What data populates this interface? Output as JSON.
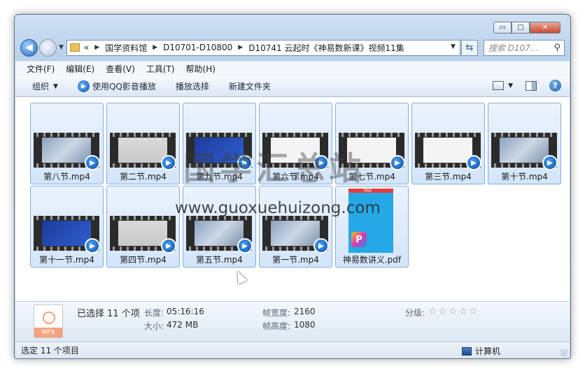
{
  "window": {
    "caption_buttons": {
      "minimize": "▭",
      "maximize": "□",
      "close": "✕"
    }
  },
  "nav": {
    "history_glyph": "«",
    "breadcrumb": [
      "国学资料馆",
      "D10701-D10800",
      "D10741 云起时《神易数新课》视频11集"
    ],
    "search_placeholder": "搜索 D107...",
    "search_icon": "magnifier-icon"
  },
  "menu": [
    "文件(F)",
    "编辑(E)",
    "查看(V)",
    "工具(T)",
    "帮助(H)"
  ],
  "commands": {
    "organize": "组织",
    "play_qq": "使用QQ影音播放",
    "play_selection": "播放选择",
    "new_folder": "新建文件夹"
  },
  "files": [
    {
      "name": "第八节.mp4",
      "thumb": "photo"
    },
    {
      "name": "第二节.mp4",
      "thumb": "gray"
    },
    {
      "name": "第九节.mp4",
      "thumb": "blue"
    },
    {
      "name": "第六节.mp4",
      "thumb": "paper"
    },
    {
      "name": "第七节.mp4",
      "thumb": "paper"
    },
    {
      "name": "第三节.mp4",
      "thumb": "paper"
    },
    {
      "name": "第十节.mp4",
      "thumb": "photo"
    },
    {
      "name": "第十一节.mp4",
      "thumb": "blue"
    },
    {
      "name": "第四节.mp4",
      "thumb": "gray"
    },
    {
      "name": "第五节.mp4",
      "thumb": "photo"
    },
    {
      "name": "第一节.mp4",
      "thumb": "photo"
    },
    {
      "name": "神易数讲义.pdf",
      "thumb": "pdf"
    }
  ],
  "details": {
    "icon_label": "MP4",
    "selected": "已选择 11 个项",
    "length_label": "长度:",
    "length_value": "05:16:16",
    "size_label": "大小:",
    "size_value": "472 MB",
    "width_label": "帧宽度:",
    "width_value": "2160",
    "height_label": "帧高度:",
    "height_value": "1080",
    "rating_label": "分级:",
    "rating_stars": "☆☆☆☆☆"
  },
  "status": {
    "text": "选定 11 个项目",
    "computer": "计算机"
  },
  "watermark": {
    "title": "国学汇总站",
    "url": "www.guoxuehuizong.com"
  }
}
